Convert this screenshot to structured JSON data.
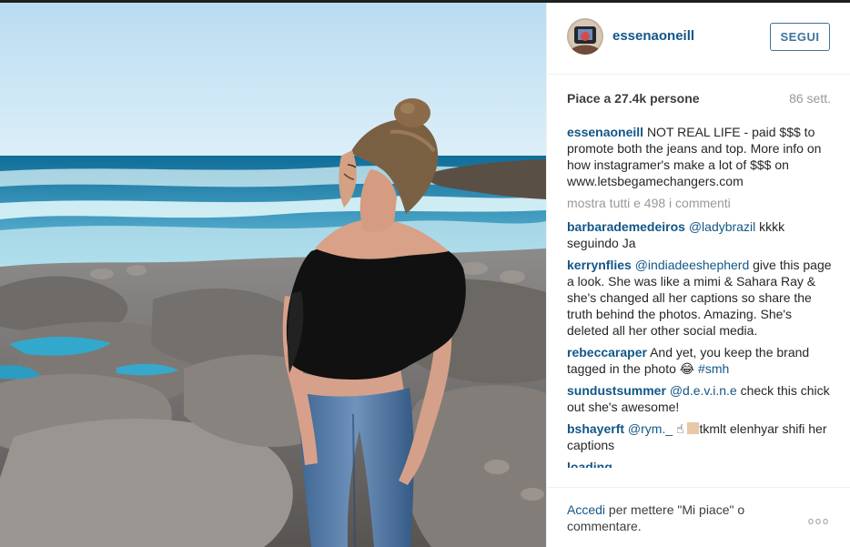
{
  "post": {
    "image_alt": "",
    "author": {
      "username": "essenaoneill",
      "follow_label": "SEGUI"
    },
    "likes_text": "Piace a 27.4k persone",
    "time_text": "86 sett.",
    "caption": {
      "user": "essenaoneill",
      "text": "NOT REAL LIFE - paid $$$ to promote both the jeans and top. More info on how instagramer's make a lot of $$$ on www.letsbegamechangers.com"
    },
    "show_all_comments": "mostra tutti e 498 i commenti",
    "comments": [
      {
        "user": "barbarademedeiros",
        "mention": "@ladybrazil",
        "text": " kkkk seguindo Ja"
      },
      {
        "user": "kerrynflies",
        "mention": "@indiadeeshepherd",
        "text": " give this page a look. She was like a mimi & Sahara Ray & she's changed all her captions so share the truth behind the photos. Amazing. She's deleted all her other social media."
      },
      {
        "user": "rebeccaraper",
        "text_before": " And yet, you keep the brand tagged in the photo ",
        "emoji": "😂",
        "hashtag": "#smh"
      },
      {
        "user": "sundustsummer",
        "mention": "@d.e.v.i.n.e",
        "text": " check this chick out she's awesome!"
      },
      {
        "user": "bshayerft",
        "mention": "@rym._",
        "text_before": " ☝",
        "text_after": "tkmlt elenhyar shifi her captions"
      }
    ],
    "partial_comment": "loading...",
    "footer": {
      "login_link": "Accedi",
      "login_rest": " per mettere \"Mi piace\" o commentare.",
      "more_dots": "ooo"
    }
  },
  "colors": {
    "link": "#125688",
    "follow": "#3f729b",
    "muted": "#999999"
  },
  "icons": {
    "avatar": "profile-avatar",
    "more": "more-options-icon"
  }
}
